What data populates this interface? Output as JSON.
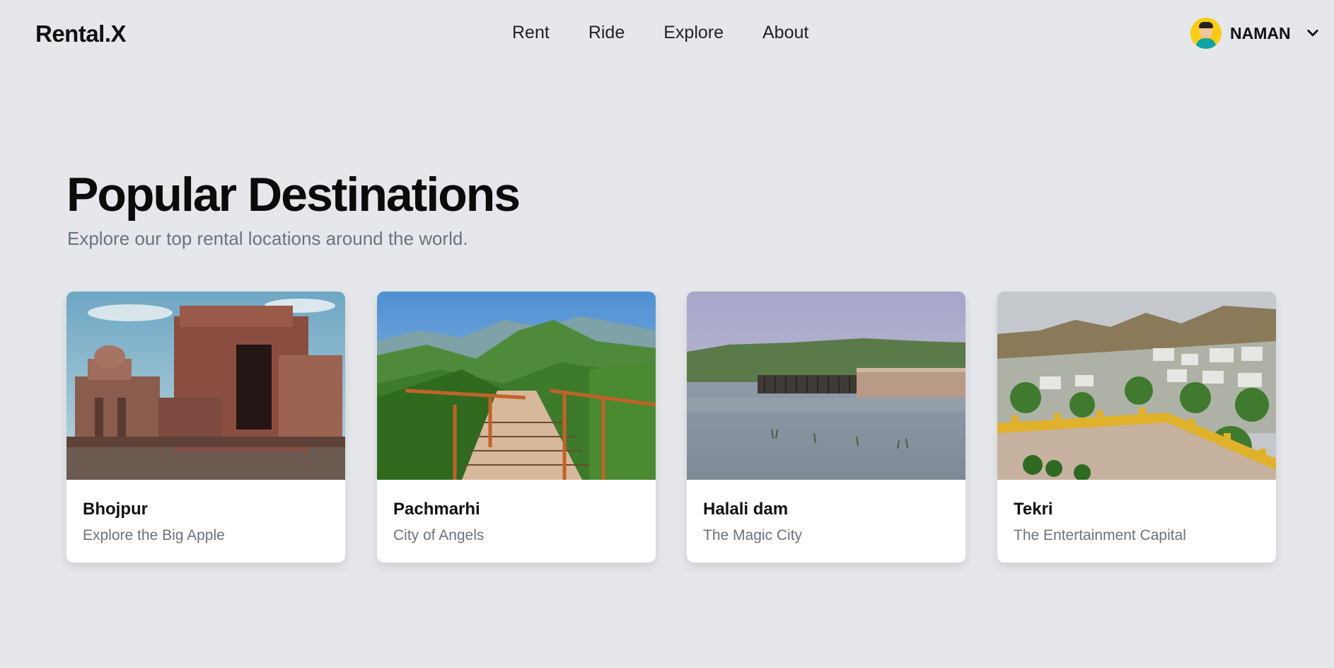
{
  "app": {
    "brand": "Rental.X"
  },
  "nav": {
    "links": [
      "Rent",
      "Ride",
      "Explore",
      "About"
    ]
  },
  "user": {
    "name": "NAMAN"
  },
  "hero": {
    "title": "Popular Destinations",
    "subtitle": "Explore our top rental locations around the world."
  },
  "cards": [
    {
      "title": "Bhojpur",
      "tagline": "Explore the Big Apple"
    },
    {
      "title": "Pachmarhi",
      "tagline": "City of Angels"
    },
    {
      "title": "Halali dam",
      "tagline": "The Magic City"
    },
    {
      "title": "Tekri",
      "tagline": "The Entertainment Capital"
    }
  ],
  "colors": {
    "background": "#e5e7eb",
    "avatar": "#facc15",
    "muted": "#6b7280"
  },
  "icons": {
    "user_menu": "chevron-down-icon",
    "avatar": "avatar-icon"
  }
}
